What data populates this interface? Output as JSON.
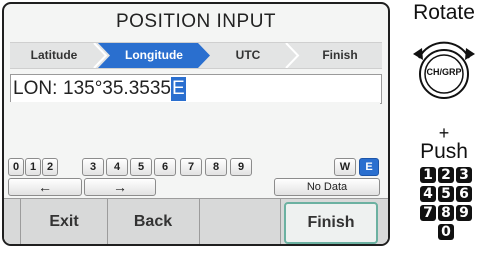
{
  "screen": {
    "title": "POSITION INPUT",
    "steps": [
      "Latitude",
      "Longitude",
      "UTC",
      "Finish"
    ],
    "active_step": "Longitude",
    "entry": {
      "label": "LON:",
      "value": "135°35.3535",
      "cursor_char": "E"
    },
    "keypad": {
      "digits": [
        "0",
        "1",
        "2",
        "3",
        "4",
        "5",
        "6",
        "7",
        "8",
        "9"
      ],
      "hemispheres": [
        "W",
        "E"
      ],
      "selected_hemisphere": "E",
      "left_arrow": "←",
      "right_arrow": "→",
      "no_data_label": "No Data"
    },
    "softkeys": [
      "Exit",
      "Back",
      "",
      "Finish"
    ],
    "selected_softkey": "Finish"
  },
  "instructions": {
    "rotate_label": "Rotate",
    "knob_label": "CH/GRP",
    "plus": "+",
    "push_label": "Push",
    "digit_keys": [
      "1",
      "2",
      "3",
      "4",
      "5",
      "6",
      "7",
      "8",
      "9",
      "0"
    ]
  },
  "colors": {
    "accent_blue": "#2a6fcf",
    "selection_green": "#6bb1a1"
  }
}
